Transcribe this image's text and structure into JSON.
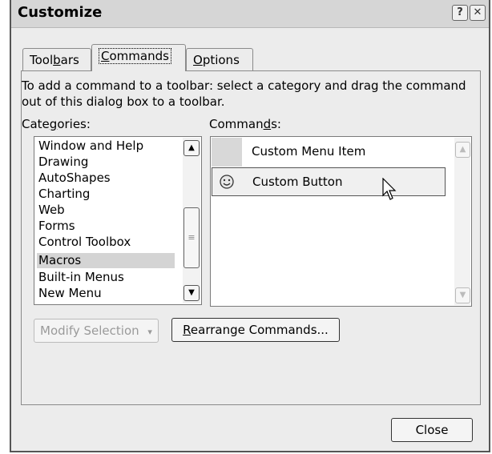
{
  "window": {
    "title": "Customize",
    "help_glyph": "?",
    "close_glyph": "✕"
  },
  "tabs": [
    {
      "pre": "Tool",
      "key": "b",
      "post": "ars",
      "active": false
    },
    {
      "pre": "",
      "key": "C",
      "post": "ommands",
      "active": true
    },
    {
      "pre": "",
      "key": "O",
      "post": "ptions",
      "active": false
    }
  ],
  "instructions": "To add a command to a toolbar: select a category and drag the command out of this dialog box to a toolbar.",
  "categories": {
    "label_pre": "Cate",
    "label_key": "g",
    "label_post": "ories:",
    "items": [
      "Window and Help",
      "Drawing",
      "AutoShapes",
      "Charting",
      "Web",
      "Forms",
      "Control Toolbox",
      "Macros",
      "Built-in Menus",
      "New Menu"
    ],
    "selected": "Macros"
  },
  "commands": {
    "label_pre": "Comman",
    "label_key": "d",
    "label_post": "s:",
    "items": [
      {
        "label": "Custom Menu Item",
        "icon": "none"
      },
      {
        "label": "Custom Button",
        "icon": "smiley-icon"
      }
    ]
  },
  "buttons": {
    "modify_selection": "Modify Selection",
    "modify_arrow": "▾",
    "rearrange_key": "R",
    "rearrange_post": "earrange Commands...",
    "close": "Close"
  },
  "scroll_glyphs": {
    "up": "▲",
    "down": "▼",
    "grip": "≡"
  }
}
